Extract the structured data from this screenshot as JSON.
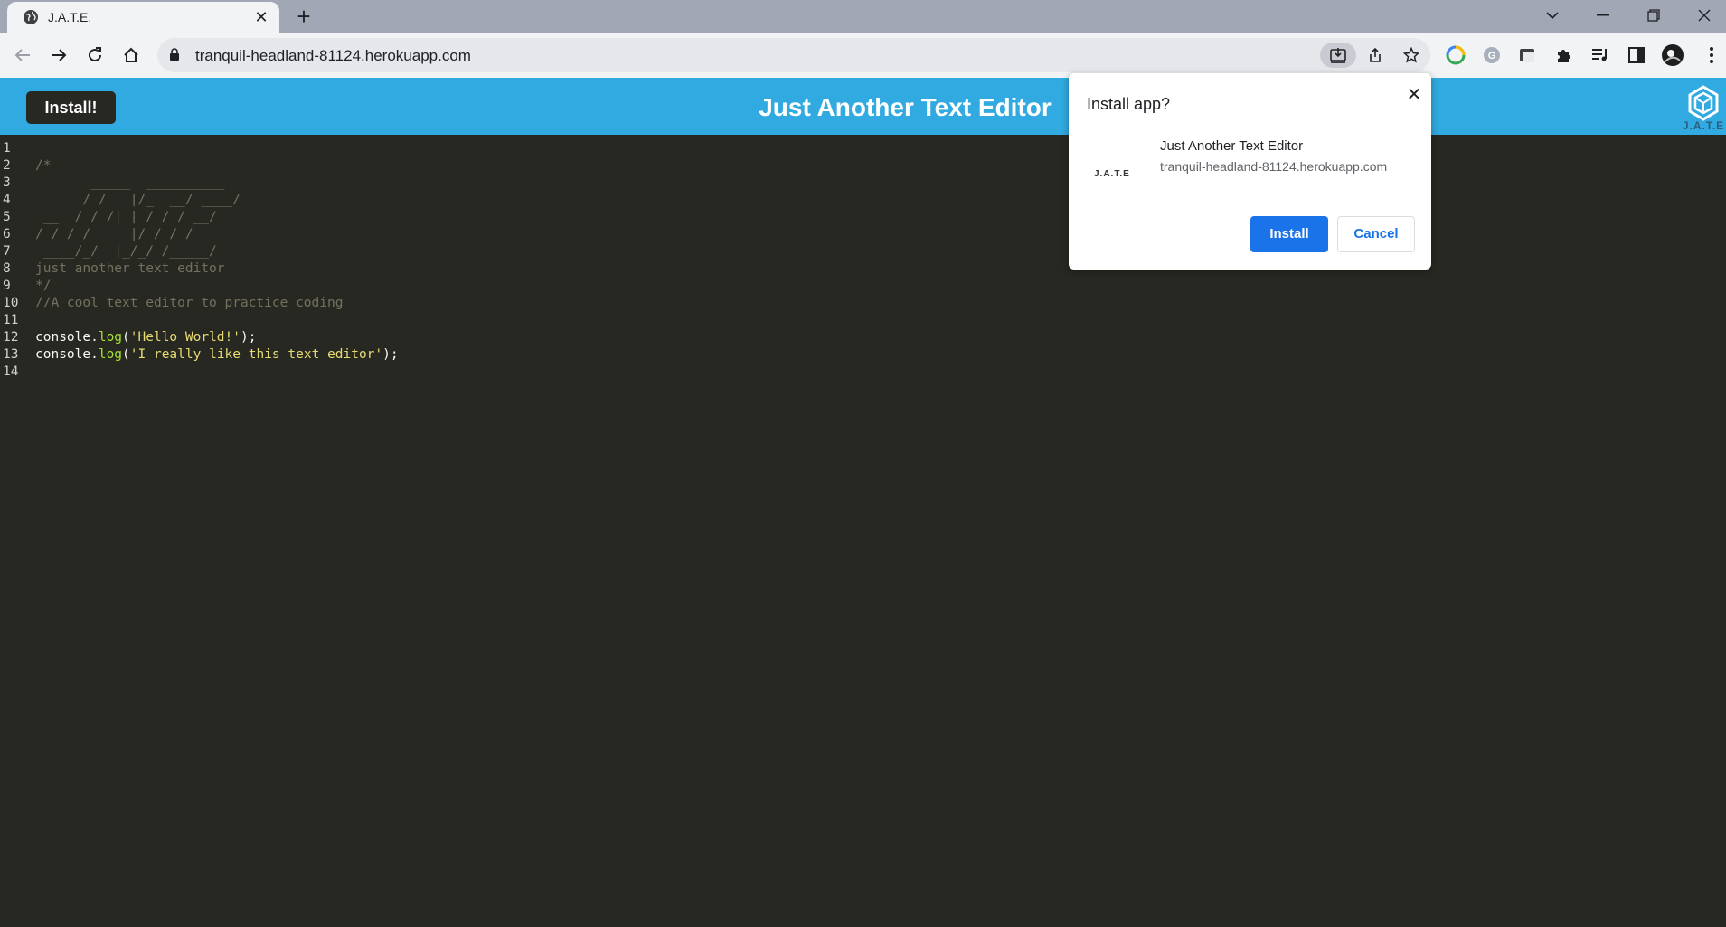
{
  "browser": {
    "tab_title": "J.A.T.E.",
    "url": "tranquil-headland-81124.herokuapp.com"
  },
  "app": {
    "install_button": "Install!",
    "title": "Just Another Text Editor",
    "logo_text": "J.A.T.E"
  },
  "editor": {
    "line_numbers": [
      "1",
      "2",
      "3",
      "4",
      "5",
      "6",
      "7",
      "8",
      "9",
      "10",
      "11",
      "12",
      "13",
      "14"
    ],
    "lines": [
      {
        "parts": [
          {
            "t": "",
            "c": ""
          }
        ]
      },
      {
        "parts": [
          {
            "t": "/*",
            "c": "cm"
          }
        ]
      },
      {
        "parts": [
          {
            "t": "       _____  __________",
            "c": "cm"
          }
        ]
      },
      {
        "parts": [
          {
            "t": "      / /   |/_  __/ ____/",
            "c": "cm"
          }
        ]
      },
      {
        "parts": [
          {
            "t": " __  / / /| | / / / __/",
            "c": "cm"
          }
        ]
      },
      {
        "parts": [
          {
            "t": "/ /_/ / ___ |/ / / /___",
            "c": "cm"
          }
        ]
      },
      {
        "parts": [
          {
            "t": " ____/_/  |_/_/ /_____/",
            "c": "cm"
          }
        ]
      },
      {
        "parts": [
          {
            "t": "just another text editor",
            "c": "cm"
          }
        ]
      },
      {
        "parts": [
          {
            "t": "*/",
            "c": "cm"
          }
        ]
      },
      {
        "parts": [
          {
            "t": "//A cool text editor to practice coding",
            "c": "cm"
          }
        ]
      },
      {
        "parts": [
          {
            "t": "",
            "c": ""
          }
        ]
      },
      {
        "parts": [
          {
            "t": "console.",
            "c": ""
          },
          {
            "t": "log",
            "c": "fn"
          },
          {
            "t": "(",
            "c": ""
          },
          {
            "t": "'Hello World!'",
            "c": "str"
          },
          {
            "t": ");",
            "c": ""
          }
        ]
      },
      {
        "parts": [
          {
            "t": "console.",
            "c": ""
          },
          {
            "t": "log",
            "c": "fn"
          },
          {
            "t": "(",
            "c": ""
          },
          {
            "t": "'I really like this text editor'",
            "c": "str"
          },
          {
            "t": ");",
            "c": ""
          }
        ]
      },
      {
        "parts": [
          {
            "t": "",
            "c": ""
          }
        ]
      }
    ]
  },
  "install_dialog": {
    "title": "Install app?",
    "app_icon_text": "J.A.T.E",
    "app_name": "Just Another Text Editor",
    "origin": "tranquil-headland-81124.herokuapp.com",
    "install_label": "Install",
    "cancel_label": "Cancel"
  },
  "colors": {
    "header_bg": "#31a9e1",
    "editor_bg": "#272822",
    "primary_button": "#1a73e8"
  }
}
